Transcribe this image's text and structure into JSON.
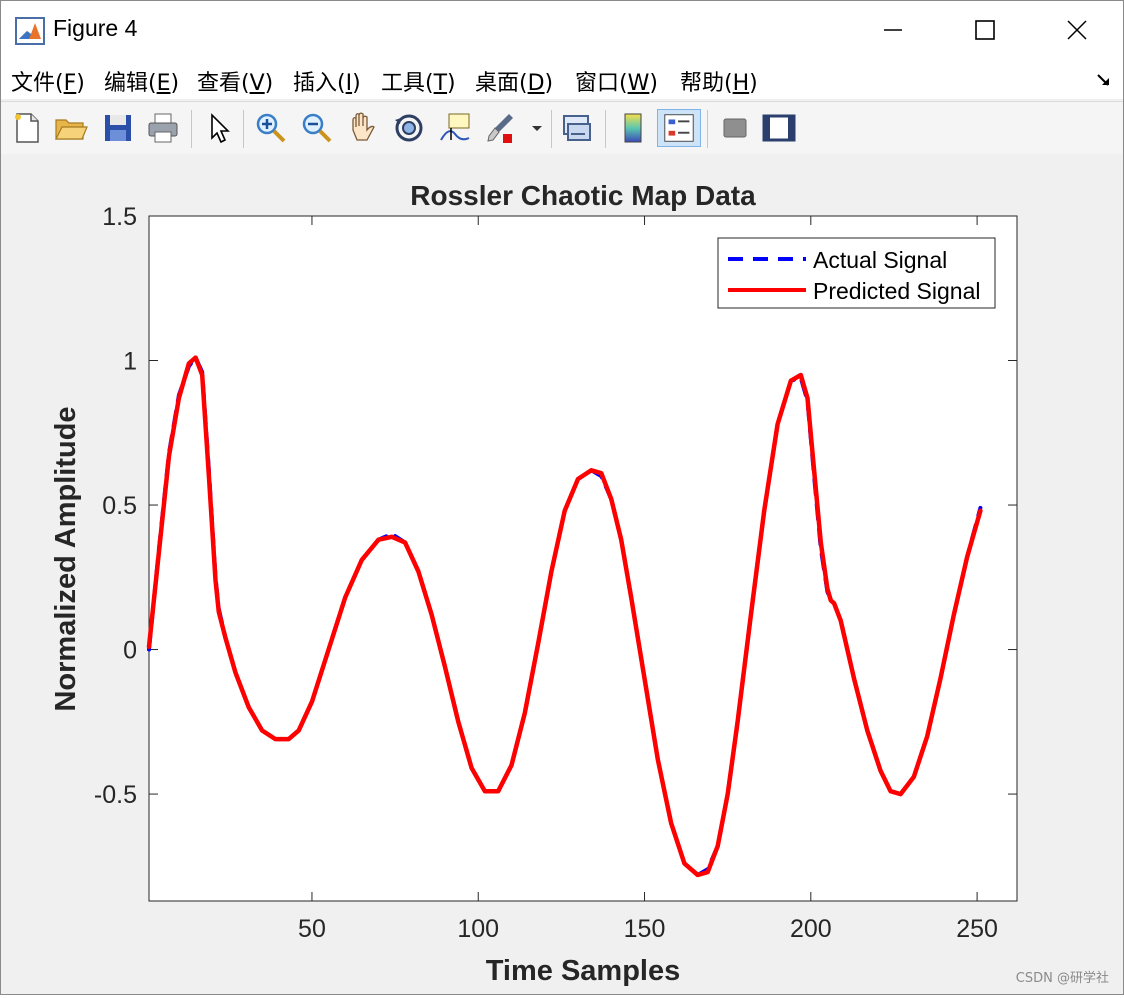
{
  "window": {
    "title": "Figure 4"
  },
  "menu": [
    {
      "text": "文件(",
      "key": "F",
      "tail": ")"
    },
    {
      "text": "编辑(",
      "key": "E",
      "tail": ")"
    },
    {
      "text": "查看(",
      "key": "V",
      "tail": ")"
    },
    {
      "text": "插入(",
      "key": "I",
      "tail": ")"
    },
    {
      "text": "工具(",
      "key": "T",
      "tail": ")"
    },
    {
      "text": "桌面(",
      "key": "D",
      "tail": ")"
    },
    {
      "text": "窗口(",
      "key": "W",
      "tail": ")"
    },
    {
      "text": "帮助(",
      "key": "H",
      "tail": ")"
    }
  ],
  "toolbar": {
    "icons": [
      "new-figure-icon",
      "open-file-icon",
      "save-icon",
      "print-icon",
      "pointer-icon",
      "zoom-in-icon",
      "zoom-out-icon",
      "pan-hand-icon",
      "rotate-3d-icon",
      "data-cursor-icon",
      "brush-icon",
      "link-plot-icon",
      "colorbar-icon",
      "legend-icon",
      "hide-plot-tools-icon",
      "show-plot-tools-icon"
    ],
    "active": "legend-icon"
  },
  "watermark": "CSDN @研学社",
  "chart_data": {
    "type": "line",
    "title": "Rossler Chaotic Map Data",
    "xlabel": "Time Samples",
    "ylabel": "Normalized Amplitude",
    "xlim": [
      1,
      262
    ],
    "ylim": [
      -0.87,
      1.5
    ],
    "xticks": [
      50,
      100,
      150,
      200,
      250
    ],
    "yticks": [
      -0.5,
      0,
      0.5,
      1,
      1.5
    ],
    "ytick_labels": [
      "-0.5",
      "0",
      "0.5",
      "1",
      "1.5"
    ],
    "grid": false,
    "legend_position": "top-right",
    "series": [
      {
        "name": "Actual Signal",
        "color": "#0000ff",
        "style": "dashed",
        "x": [
          1,
          4,
          7,
          10,
          13,
          15,
          17,
          19,
          21,
          22,
          24,
          27,
          31,
          35,
          39,
          43,
          46,
          50,
          55,
          60,
          65,
          70,
          74,
          78,
          82,
          86,
          90,
          94,
          98,
          102,
          106,
          110,
          114,
          118,
          122,
          126,
          130,
          134,
          137,
          140,
          143,
          146,
          150,
          154,
          158,
          162,
          166,
          169,
          172,
          175,
          178,
          182,
          186,
          190,
          194,
          197,
          199,
          201,
          203,
          205,
          206,
          207,
          209,
          213,
          217,
          221,
          224,
          227,
          231,
          235,
          239,
          243,
          247,
          251
        ],
        "y": [
          0.0,
          0.35,
          0.68,
          0.88,
          0.98,
          1.01,
          0.96,
          0.62,
          0.25,
          0.14,
          0.04,
          -0.08,
          -0.2,
          -0.28,
          -0.31,
          -0.31,
          -0.28,
          -0.18,
          0.0,
          0.18,
          0.31,
          0.38,
          0.4,
          0.37,
          0.27,
          0.12,
          -0.06,
          -0.25,
          -0.41,
          -0.49,
          -0.49,
          -0.4,
          -0.22,
          0.02,
          0.27,
          0.48,
          0.59,
          0.62,
          0.6,
          0.52,
          0.38,
          0.18,
          -0.1,
          -0.38,
          -0.6,
          -0.74,
          -0.78,
          -0.76,
          -0.68,
          -0.5,
          -0.25,
          0.12,
          0.48,
          0.78,
          0.93,
          0.94,
          0.86,
          0.6,
          0.35,
          0.2,
          0.17,
          0.16,
          0.1,
          -0.1,
          -0.28,
          -0.42,
          -0.49,
          -0.5,
          -0.44,
          -0.3,
          -0.1,
          0.12,
          0.32,
          0.49
        ]
      },
      {
        "name": "Predicted Signal",
        "color": "#ff0000",
        "style": "solid",
        "x": [
          1,
          4,
          7,
          10,
          13,
          15,
          17,
          19,
          21,
          22,
          24,
          27,
          31,
          35,
          39,
          43,
          46,
          50,
          55,
          60,
          65,
          70,
          74,
          78,
          82,
          86,
          90,
          94,
          98,
          102,
          106,
          110,
          114,
          118,
          122,
          126,
          130,
          134,
          137,
          140,
          143,
          146,
          150,
          154,
          158,
          162,
          166,
          169,
          172,
          175,
          178,
          182,
          186,
          190,
          194,
          197,
          199,
          201,
          203,
          205,
          206,
          207,
          209,
          213,
          217,
          221,
          224,
          227,
          231,
          235,
          239,
          243,
          247,
          251
        ],
        "y": [
          0.01,
          0.34,
          0.67,
          0.87,
          0.99,
          1.01,
          0.95,
          0.6,
          0.24,
          0.13,
          0.04,
          -0.08,
          -0.2,
          -0.28,
          -0.31,
          -0.31,
          -0.28,
          -0.18,
          0.0,
          0.18,
          0.31,
          0.38,
          0.39,
          0.37,
          0.27,
          0.12,
          -0.06,
          -0.25,
          -0.41,
          -0.49,
          -0.49,
          -0.4,
          -0.22,
          0.02,
          0.27,
          0.48,
          0.59,
          0.62,
          0.61,
          0.52,
          0.38,
          0.18,
          -0.1,
          -0.38,
          -0.6,
          -0.74,
          -0.78,
          -0.77,
          -0.68,
          -0.5,
          -0.25,
          0.12,
          0.48,
          0.78,
          0.93,
          0.95,
          0.87,
          0.62,
          0.37,
          0.21,
          0.17,
          0.16,
          0.1,
          -0.1,
          -0.28,
          -0.42,
          -0.49,
          -0.5,
          -0.44,
          -0.3,
          -0.1,
          0.12,
          0.32,
          0.48
        ]
      }
    ]
  }
}
